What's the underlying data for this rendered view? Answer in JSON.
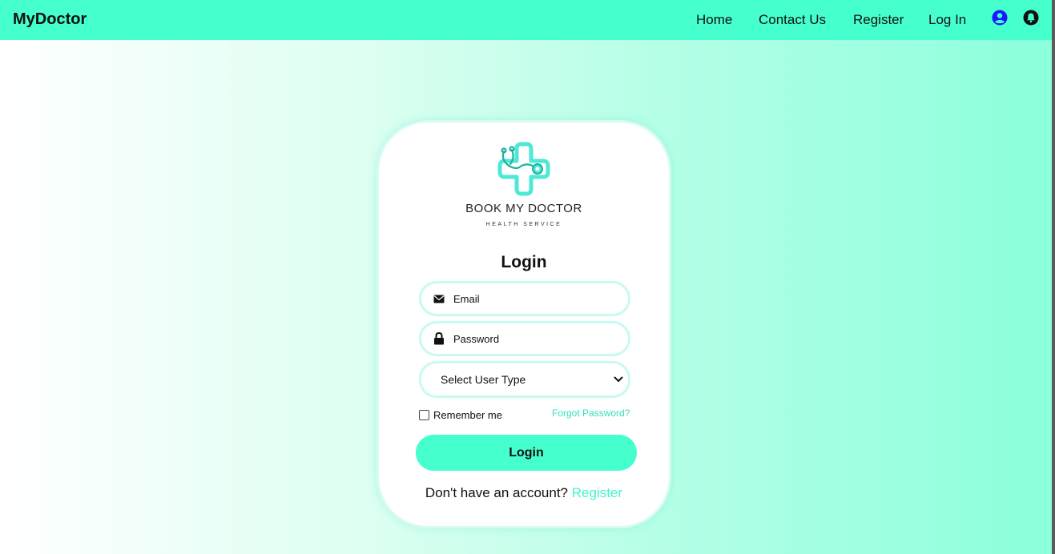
{
  "navbar": {
    "brand": "MyDoctor",
    "links": [
      "Home",
      "Contact Us",
      "Register",
      "Log In"
    ],
    "icons": [
      "user-circle-icon",
      "bell-icon"
    ],
    "colors": {
      "background": "#45ffcc",
      "user_icon": "#1a1aff"
    }
  },
  "card": {
    "logo": {
      "title": "BOOK MY DOCTOR",
      "subtitle": "HEALTH SERVICE"
    },
    "title": "Login",
    "email": {
      "placeholder": "Email",
      "icon": "envelope-icon"
    },
    "password": {
      "placeholder": "Password",
      "icon": "lock-icon"
    },
    "user_type": {
      "selected": "Select User Type",
      "icon": "chevron-down-icon"
    },
    "remember_label": "Remember me",
    "forgot_label": "Forgot Password?",
    "login_button": "Login",
    "register_prompt": "Don't have an account?",
    "register_link": "Register",
    "colors": {
      "accent": "#45ffcc",
      "link": "#33e0c0",
      "logo": "#4ee8d6"
    }
  }
}
